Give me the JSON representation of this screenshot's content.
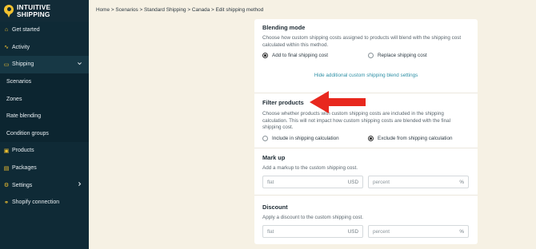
{
  "brand": {
    "line1": "INTUITIVE",
    "line2": "SHIPPING"
  },
  "sidebar": {
    "items": [
      {
        "label": "Get started",
        "icon": "home-icon",
        "glyph": "⌂"
      },
      {
        "label": "Activity",
        "icon": "activity-icon",
        "glyph": "∿"
      },
      {
        "label": "Shipping",
        "icon": "truck-icon",
        "glyph": "▭"
      },
      {
        "label": "Scenarios"
      },
      {
        "label": "Zones"
      },
      {
        "label": "Rate blending"
      },
      {
        "label": "Condition groups"
      },
      {
        "label": "Products",
        "icon": "box-icon",
        "glyph": "▣"
      },
      {
        "label": "Packages",
        "icon": "package-icon",
        "glyph": "▤"
      },
      {
        "label": "Settings",
        "icon": "gear-icon",
        "glyph": "⚙"
      },
      {
        "label": "Shopify connection",
        "icon": "link-icon",
        "glyph": "⚭"
      }
    ]
  },
  "breadcrumb": "Home > Scenarios > Standard Shipping > Canada > Edit shipping method",
  "blending": {
    "title": "Blending mode",
    "desc": "Choose how custom shipping costs assigned to products will blend with the shipping cost calculated within this method.",
    "option1": "Add to final shipping cost",
    "option2": "Replace shipping cost",
    "toggle_link": "Hide additional custom shipping blend settings"
  },
  "filter": {
    "title": "Filter products",
    "desc": "Choose whether products with custom shipping costs are included in the shipping calculation. This will not impact how custom shipping costs are blended with the final shipping cost.",
    "option1": "Include in shipping calculation",
    "option2": "Exclude from shipping calculation"
  },
  "markup": {
    "title": "Mark up",
    "desc": "Add a markup to the custom shipping cost.",
    "flat_placeholder": "flat",
    "flat_suffix": "USD",
    "percent_placeholder": "percent",
    "percent_suffix": "%"
  },
  "discount": {
    "title": "Discount",
    "desc": "Apply a discount to the custom shipping cost.",
    "flat_placeholder": "flat",
    "flat_suffix": "USD",
    "percent_placeholder": "percent",
    "percent_suffix": "%"
  },
  "colors": {
    "sidebar": "#0f2a36",
    "accent": "#f2c230",
    "link": "#2d8fa5",
    "arrow": "#e8281e",
    "page": "#f6f1e4"
  }
}
